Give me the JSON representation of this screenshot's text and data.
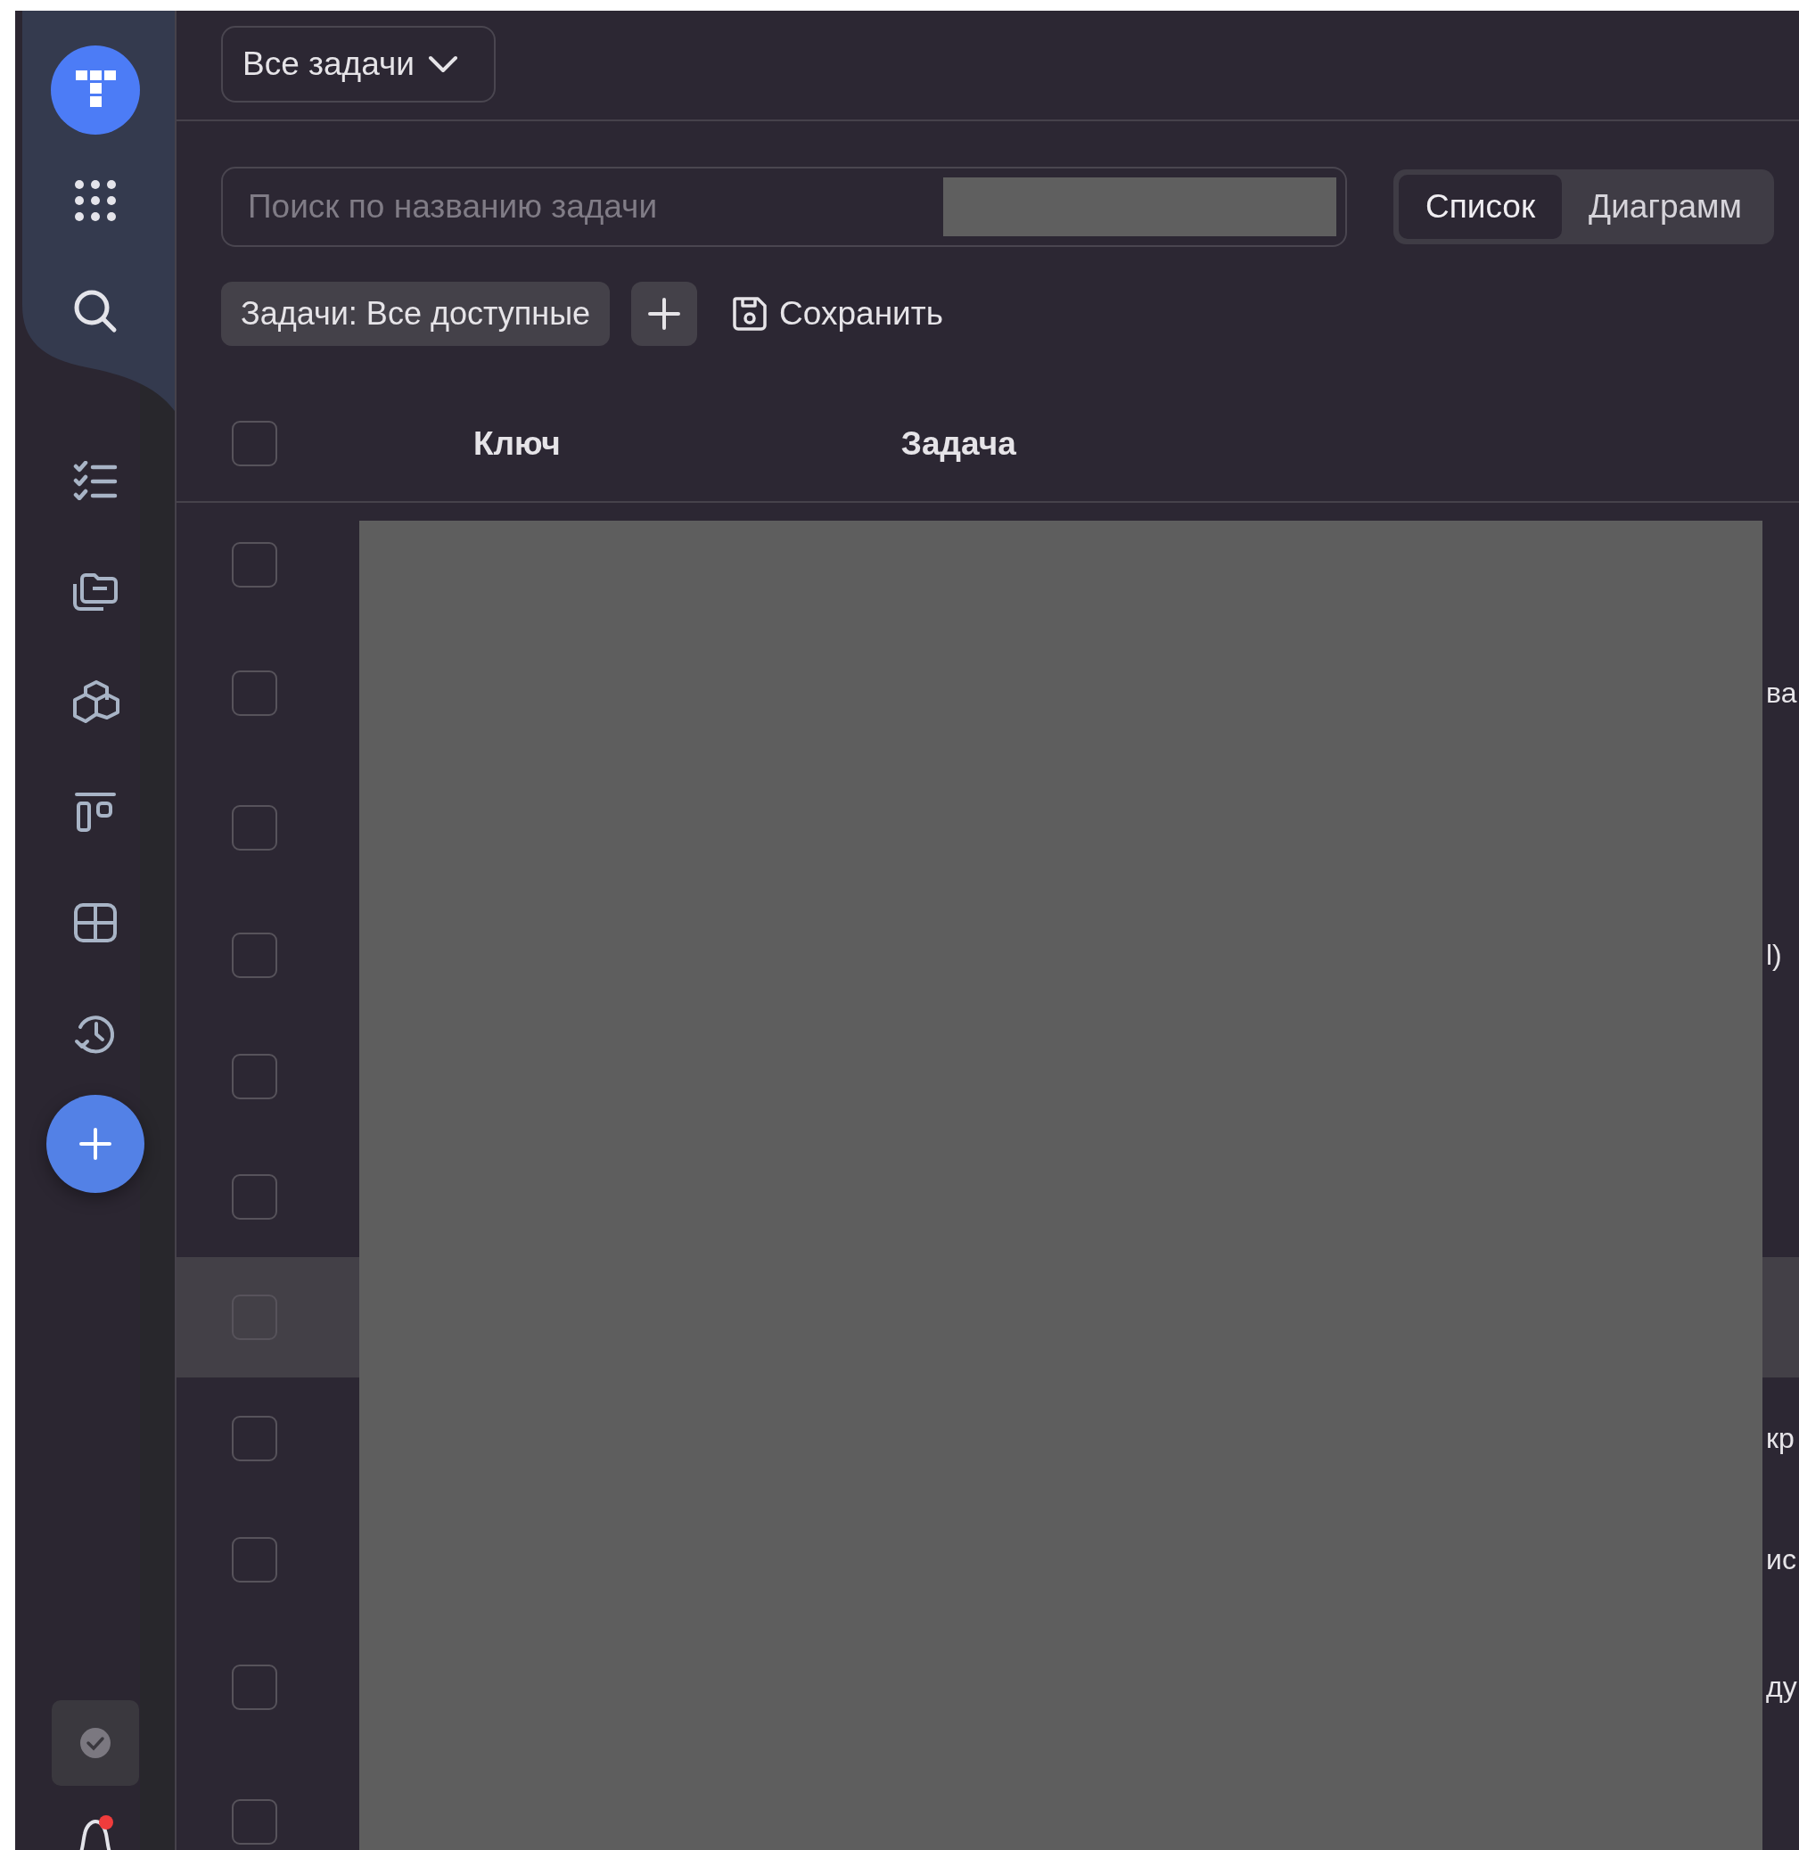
{
  "sidebar": {
    "notifications": {
      "unread": true
    }
  },
  "header": {
    "view_selector": "Все задачи"
  },
  "search": {
    "placeholder": "Поиск по названию задачи"
  },
  "view_tabs": [
    {
      "label": "Список",
      "selected": true
    },
    {
      "label": "Диаграмм",
      "selected": false
    }
  ],
  "filter": {
    "label": "Задачи: Все доступные"
  },
  "save_button": "Сохранить",
  "table": {
    "select_all": {
      "checked": false
    },
    "columns": [
      "Ключ",
      "Задача"
    ],
    "rows": [
      {
        "checked": false,
        "highlighted": false
      },
      {
        "checked": false,
        "highlighted": false,
        "column_3": "ва"
      },
      {
        "checked": false,
        "highlighted": false
      },
      {
        "checked": false,
        "highlighted": false,
        "column_3": "l)"
      },
      {
        "checked": false,
        "highlighted": false
      },
      {
        "checked": false,
        "highlighted": false
      },
      {
        "checked": false,
        "highlighted": true
      },
      {
        "checked": false,
        "highlighted": false,
        "column_3": "кр"
      },
      {
        "checked": false,
        "highlighted": false,
        "column_3": "ис"
      },
      {
        "checked": false,
        "highlighted": false,
        "column_3": "ду"
      },
      {
        "checked": false,
        "highlighted": false
      }
    ]
  }
}
